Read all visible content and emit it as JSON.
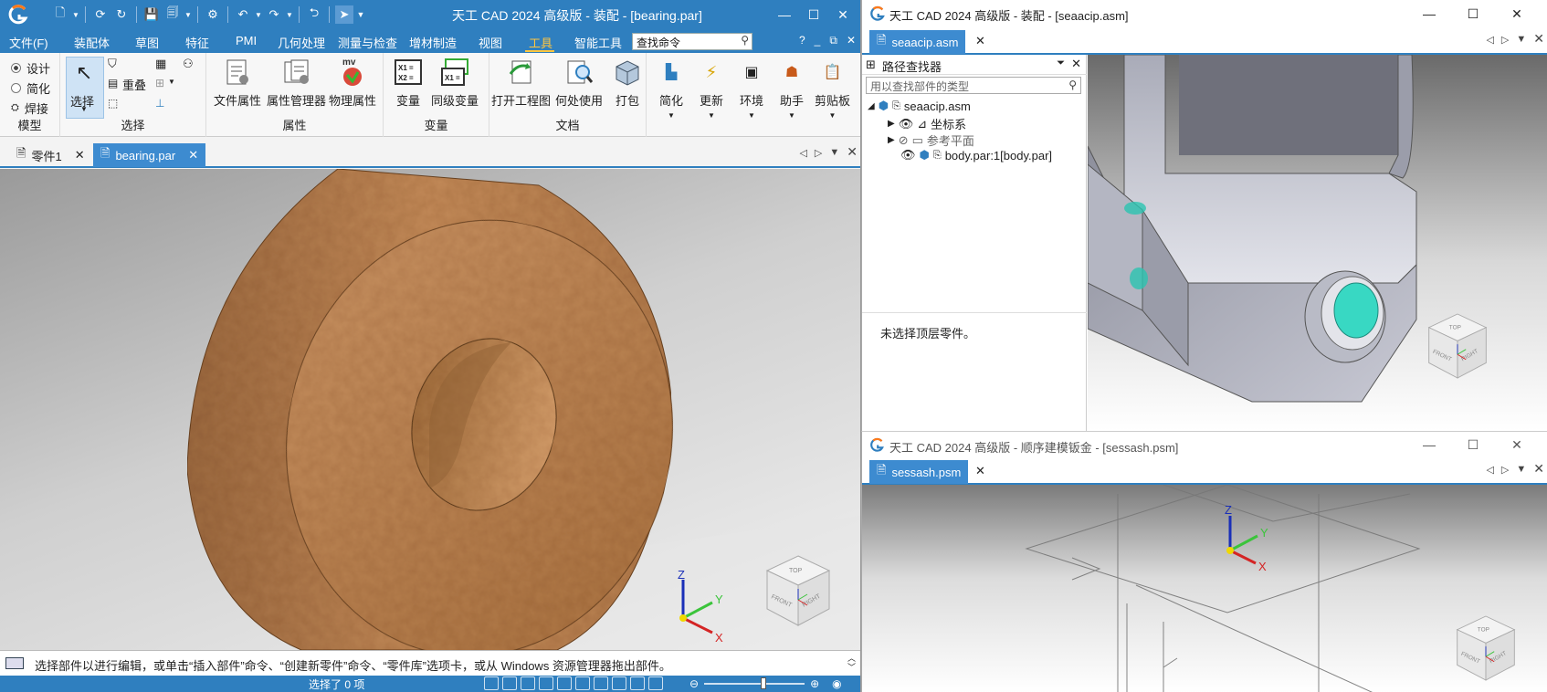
{
  "main_window": {
    "title": "天工 CAD 2024 高级版 - 装配 - [bearing.par]",
    "menu": {
      "file": "文件(F)",
      "items": [
        "装配体",
        "草图",
        "特征",
        "PMI",
        "几何处理",
        "测量与检查",
        "增材制造",
        "视图",
        "工具",
        "智能工具"
      ],
      "active": "工具",
      "search_value": "查找命令",
      "help": "?"
    },
    "ribbon": {
      "model_group": {
        "label": "模型",
        "options": [
          "设计",
          "简化",
          "焊接"
        ],
        "selected": "设计"
      },
      "select_group": {
        "label": "选择",
        "select_button": "选择",
        "overlap": "重叠"
      },
      "properties_group": {
        "label": "属性",
        "buttons": [
          "文件属性",
          "属性管理器",
          "物理属性"
        ],
        "mv_badge": "mv"
      },
      "variables_group": {
        "label": "变量",
        "buttons": [
          "变量",
          "同级变量"
        ],
        "icon1_text": "X1 = X2 =",
        "icon2_text": "X1 ="
      },
      "document_group": {
        "label": "文档",
        "buttons": [
          "打开工程图",
          "何处使用",
          "打包"
        ]
      },
      "extra_buttons": [
        "简化",
        "更新",
        "环境",
        "助手",
        "剪贴板"
      ]
    },
    "tabs": [
      {
        "label": "零件1",
        "active": false
      },
      {
        "label": "bearing.par",
        "active": true
      }
    ],
    "status_prompt": "选择部件以进行编辑，或单击“插入部件”命令、“创建新零件”命令、“零件库”选项卡，或从 Windows 资源管理器拖出部件。",
    "status_selected": "选择了 0 项",
    "triad": {
      "x": "X",
      "y": "Y",
      "z": "Z"
    },
    "viewcube": {
      "top": "TOP",
      "front": "FRONT",
      "right": "RIGHT"
    }
  },
  "assembly_window": {
    "title": "天工 CAD 2024 高级版 - 装配 - [seaacip.asm]",
    "tab": "seaacip.asm",
    "pathfinder": {
      "title": "路径查找器",
      "filter_placeholder": "用以查找部件的类型",
      "root": "seaacip.asm",
      "items": [
        "坐标系",
        "参考平面",
        "body.par:1[body.par]"
      ],
      "message": "未选择顶层零件。"
    },
    "viewcube": {
      "top": "TOP",
      "front": "FRONT",
      "right": "RIGHT"
    }
  },
  "sheetmetal_window": {
    "title": "天工 CAD 2024 高级版 - 顺序建模钣金 - [sessash.psm]",
    "tab": "sessash.psm",
    "triad": {
      "x": "X",
      "y": "Y",
      "z": "Z"
    },
    "viewcube": {
      "top": "TOP",
      "front": "FRONT",
      "right": "RIGHT"
    }
  },
  "colors": {
    "accent": "#2f7fbf",
    "highlight": "#ffc640",
    "bearing": "#b97a48",
    "teal": "#3fd3c2"
  }
}
